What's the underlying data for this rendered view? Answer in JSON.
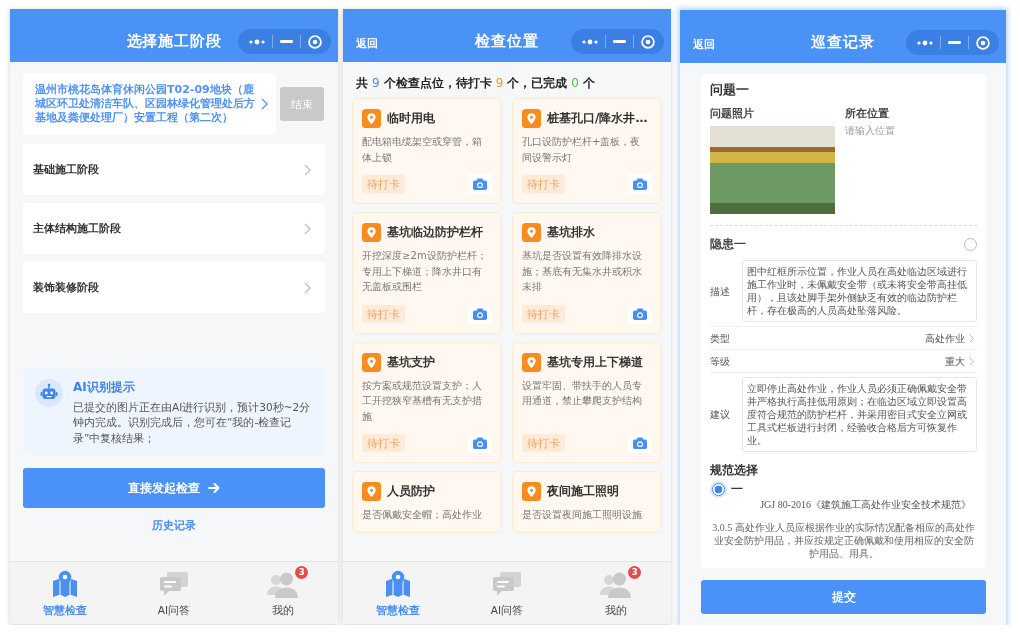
{
  "stage_screen": {
    "header": {
      "title": "选择施工阶段"
    },
    "project": {
      "name": "温州市桃花岛体育休闲公园T02-09地块（鹿城区环卫处清洁车队、区园林绿化管理处后方基地及粪便处理厂）安置工程（第二次）",
      "end_button": "结束"
    },
    "stages": [
      {
        "label": "基础施工阶段"
      },
      {
        "label": "主体结构施工阶段"
      },
      {
        "label": "装饰装修阶段"
      }
    ],
    "ai_notice": {
      "title": "AI识别提示",
      "body": "已提交的图片正在由AI进行识别，预计30秒~2分钟内完成。识别完成后，您可在“我的-检查记录”中复核结果；"
    },
    "start_button": "直接发起检查",
    "history_link": "历史记录",
    "tab_bar": [
      {
        "label": "智慧检查",
        "selected": true
      },
      {
        "label": "AI问答",
        "selected": false
      },
      {
        "label": "我的",
        "selected": false,
        "badge": "3"
      }
    ]
  },
  "location_screen": {
    "header": {
      "back": "返回",
      "title": "检查位置"
    },
    "summary": [
      {
        "kind": "text",
        "text": "共"
      },
      {
        "kind": "total",
        "text": "9"
      },
      {
        "kind": "text",
        "text": "个检查点位，待打卡"
      },
      {
        "kind": "pending",
        "text": "9"
      },
      {
        "kind": "text",
        "text": "个，已完成"
      },
      {
        "kind": "done",
        "text": "0"
      },
      {
        "kind": "text",
        "text": "个"
      }
    ],
    "points": [
      {
        "title": "临时用电",
        "description": "配电箱电缆架空或穿管，箱体上锁",
        "status": "待打卡"
      },
      {
        "title": "桩基孔口/降水井…",
        "description": "孔口设防护栏杆+盖板，夜间设警示灯",
        "status": "待打卡"
      },
      {
        "title": "基坑临边防护栏杆",
        "description": "开挖深度≥2m设防护栏杆；专用上下梯道；降水井口有无盖板或围栏",
        "status": "待打卡"
      },
      {
        "title": "基坑排水",
        "description": "基坑是否设置有效降排水设施；基底有无集水井或积水未排",
        "status": "待打卡"
      },
      {
        "title": "基坑支护",
        "description": "按方案或规范设置支护；人工开挖狭窄基槽有无支护措施",
        "status": "待打卡"
      },
      {
        "title": "基坑专用上下梯道",
        "description": "设置牢固、带扶手的人员专用通道，禁止攀爬支护结构",
        "status": "待打卡"
      },
      {
        "title": "人员防护",
        "description": "是否佩戴安全帽；高处作业"
      },
      {
        "title": "夜间施工照明",
        "description": "是否设置夜间施工照明设施"
      }
    ],
    "tab_bar": [
      {
        "label": "智慧检查",
        "selected": true
      },
      {
        "label": "AI问答",
        "selected": false
      },
      {
        "label": "我的",
        "selected": false,
        "badge": "3"
      }
    ]
  },
  "record_screen": {
    "header": {
      "back": "返回",
      "title": "巡查记录"
    },
    "issue": {
      "title": "问题一",
      "photo_label": "问题照片",
      "location": {
        "label": "所在位置",
        "placeholder": "请输入位置"
      }
    },
    "hazard": {
      "title": "隐患一",
      "checked": false,
      "fields": [
        {
          "kind": "text",
          "label": "描述",
          "value": "图中红框所示位置，作业人员在高处临边区域进行施工作业时，未佩戴安全带（或未将安全带高挂低用），且该处脚手架外侧缺乏有效的临边防护栏杆，存在极高的人员高处坠落风险。"
        },
        {
          "kind": "picker",
          "label": "类型",
          "value": "高处作业"
        },
        {
          "kind": "picker",
          "label": "等级",
          "value": "重大"
        },
        {
          "kind": "text",
          "label": "建议",
          "value": "立即停止高处作业，作业人员必须正确佩戴安全带并严格执行高挂低用原则；在临边区域立即设置高度符合规范的防护栏杆，并采用密目式安全立网或工具式栏板进行封闭，经验收合格后方可恢复作业。"
        }
      ]
    },
    "standards": {
      "title": "规范选择",
      "options": [
        {
          "label": "一",
          "selected": true
        }
      ],
      "code": "JGJ 80-2016《建筑施工高处作业安全技术规范》",
      "clause": "3.0.5 高处作业人员应根据作业的实际情况配备相应的高处作业安全防护用品，并应按规定正确佩戴和使用相应的安全防护用品、用具。"
    },
    "submit_button": "提交"
  }
}
